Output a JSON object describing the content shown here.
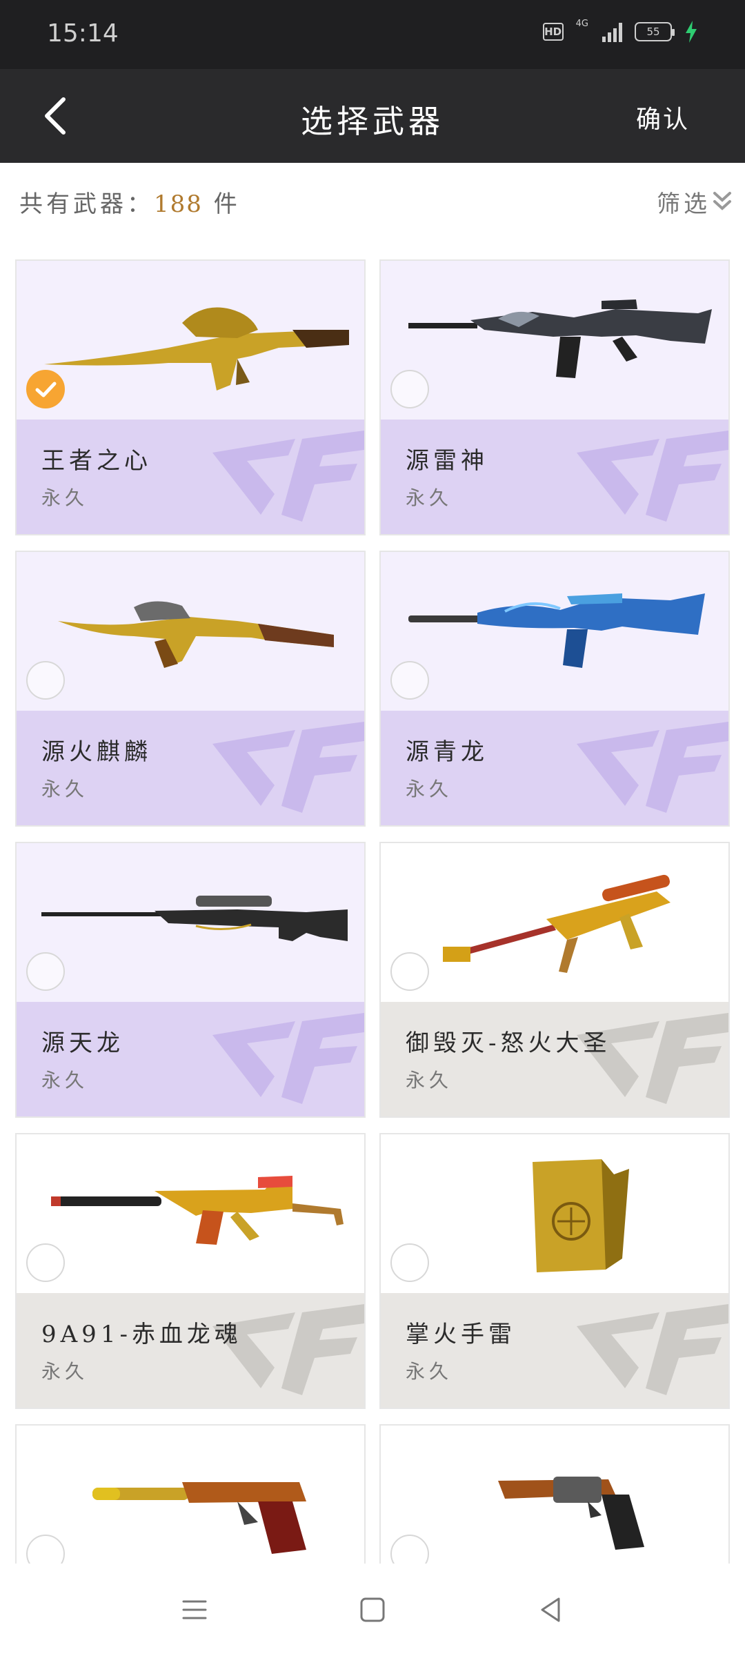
{
  "status_bar": {
    "time": "15:14",
    "hd": "HD",
    "network": "4G",
    "battery": "55"
  },
  "header": {
    "title": "选择武器",
    "confirm_label": "确认"
  },
  "summary": {
    "total_prefix": "共有武器：",
    "total_count": "188",
    "total_suffix": "件",
    "filter_label": "筛选"
  },
  "weapons": [
    {
      "name": "王者之心",
      "duration": "永久",
      "selected": true,
      "style": "purple",
      "icon": "gold-dragon-rifle-icon"
    },
    {
      "name": "源雷神",
      "duration": "永久",
      "selected": false,
      "style": "purple",
      "icon": "black-assault-rifle-icon"
    },
    {
      "name": "源火麒麟",
      "duration": "永久",
      "selected": false,
      "style": "purple",
      "icon": "fire-qilin-rifle-icon"
    },
    {
      "name": "源青龙",
      "duration": "永久",
      "selected": false,
      "style": "purple",
      "icon": "blue-dragon-rifle-icon"
    },
    {
      "name": "源天龙",
      "duration": "永久",
      "selected": false,
      "style": "purple",
      "icon": "sniper-rifle-icon"
    },
    {
      "name": "御毁灭-怒火大圣",
      "duration": "永久",
      "selected": false,
      "style": "gray",
      "icon": "heavy-sniper-icon"
    },
    {
      "name": "9A91-赤血龙魂",
      "duration": "永久",
      "selected": false,
      "style": "gray",
      "icon": "red-smg-icon"
    },
    {
      "name": "掌火手雷",
      "duration": "永久",
      "selected": false,
      "style": "gray",
      "icon": "gold-grenade-box-icon"
    },
    {
      "name": "",
      "duration": "",
      "selected": false,
      "style": "gray",
      "icon": "red-pistol-icon"
    },
    {
      "name": "",
      "duration": "",
      "selected": false,
      "style": "gray",
      "icon": "revolver-icon"
    }
  ],
  "colors": {
    "header_bg": "#2a2a2c",
    "accent_count": "#b07a2e",
    "selected_radio": "#f7a532",
    "purple_card_top": "#f4f0fd",
    "purple_card_bottom": "#ddd2f3",
    "gray_card_bottom": "#e8e6e3"
  }
}
